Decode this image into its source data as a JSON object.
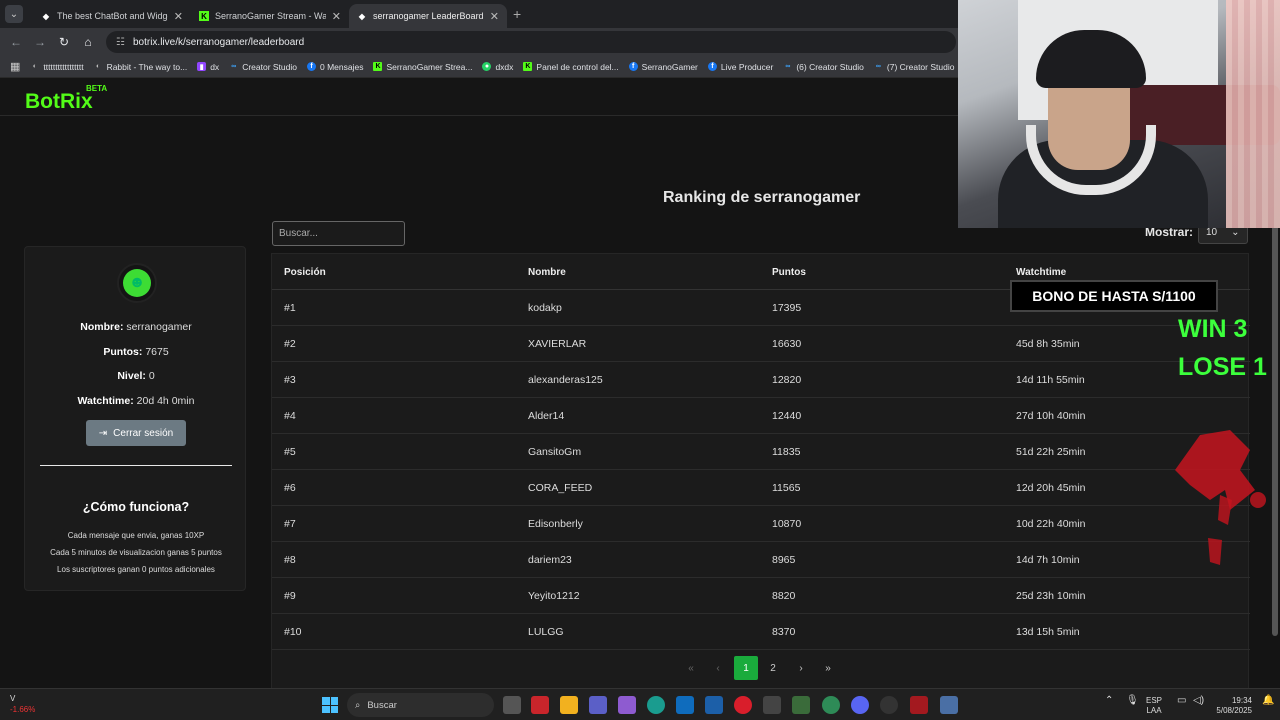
{
  "browser": {
    "tabs": [
      {
        "title": "The best ChatBot and Widgets",
        "favicon": "diamond-icon"
      },
      {
        "title": "SerranoGamer Stream - Watch",
        "favicon": "kick-icon"
      },
      {
        "title": "serranogamer LeaderBoard | Th",
        "favicon": "diamond-icon"
      }
    ],
    "url": "botrix.live/k/serranogamer/leaderboard",
    "bookmarks": [
      {
        "label": "ttttttttttttttttt",
        "icon": "n"
      },
      {
        "label": "Rabbit - The way to...",
        "icon": "n"
      },
      {
        "label": "dx",
        "icon": "t"
      },
      {
        "label": "Creator Studio",
        "icon": "c"
      },
      {
        "label": "0 Mensajes",
        "icon": "f"
      },
      {
        "label": "SerranoGamer Strea...",
        "icon": "k"
      },
      {
        "label": "dxdx",
        "icon": "g"
      },
      {
        "label": "Panel de control del...",
        "icon": "k"
      },
      {
        "label": "SerranoGamer",
        "icon": "f"
      },
      {
        "label": "Live Producer",
        "icon": "f"
      },
      {
        "label": "(6) Creator Studio",
        "icon": "c"
      },
      {
        "label": "(7) Creator Studio",
        "icon": "c"
      }
    ]
  },
  "site": {
    "logo": "BotRix",
    "logo_badge": "BETA"
  },
  "leaderboard": {
    "title": "Ranking de serranogamer",
    "search_placeholder": "Buscar...",
    "show_label": "Mostrar:",
    "show_value": "10",
    "columns": [
      "Posición",
      "Nombre",
      "Puntos",
      "Watchtime"
    ],
    "rows": [
      {
        "pos": "#1",
        "name": "kodakp",
        "points": "17395",
        "watchtime": ""
      },
      {
        "pos": "#2",
        "name": "XAVIERLAR",
        "points": "16630",
        "watchtime": "45d 8h 35min"
      },
      {
        "pos": "#3",
        "name": "alexanderas125",
        "points": "12820",
        "watchtime": "14d 11h 55min"
      },
      {
        "pos": "#4",
        "name": "Alder14",
        "points": "12440",
        "watchtime": "27d 10h 40min"
      },
      {
        "pos": "#5",
        "name": "GansitoGm",
        "points": "11835",
        "watchtime": "51d 22h 25min"
      },
      {
        "pos": "#6",
        "name": "CORA_FEED",
        "points": "11565",
        "watchtime": "12d 20h 45min"
      },
      {
        "pos": "#7",
        "name": "Edisonberly",
        "points": "10870",
        "watchtime": "10d 22h 40min"
      },
      {
        "pos": "#8",
        "name": "dariem23",
        "points": "8965",
        "watchtime": "14d 7h 10min"
      },
      {
        "pos": "#9",
        "name": "Yeyito1212",
        "points": "8820",
        "watchtime": "25d 23h 10min"
      },
      {
        "pos": "#10",
        "name": "LULGG",
        "points": "8370",
        "watchtime": "13d 15h 5min"
      }
    ],
    "pagination": {
      "pages": [
        "1",
        "2"
      ],
      "current": "1"
    }
  },
  "profile": {
    "name_label": "Nombre:",
    "name": "serranogamer",
    "points_label": "Puntos:",
    "points": "7675",
    "level_label": "Nivel:",
    "level": "0",
    "watchtime_label": "Watchtime:",
    "watchtime": "20d 4h 0min",
    "logout_label": "Cerrar sesión",
    "how_title": "¿Cómo funciona?",
    "rules": [
      "Cada mensaje que envia, ganas 10XP",
      "Cada 5 minutos de visualizacion ganas 5 puntos",
      "Los suscriptores ganan 0 puntos adicionales"
    ]
  },
  "stream_overlay": {
    "bono": "BONO DE HASTA S/1100",
    "win": "WIN 3",
    "lose": "LOSE 1"
  },
  "taskbar": {
    "stock_label": "V",
    "stock_change": "-1.66%",
    "search_label": "Buscar",
    "lang": "ESP",
    "lang_sub": "LAA",
    "time": "19:34",
    "date": "5/08/2025",
    "colors": {
      "accent": "#1aab3c",
      "brand": "#53fc18"
    }
  }
}
